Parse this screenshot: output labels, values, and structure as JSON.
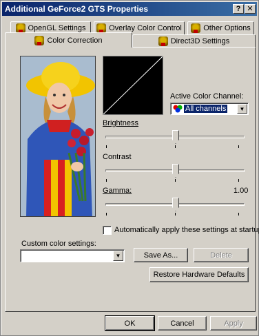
{
  "window": {
    "title": "Additional GeForce2 GTS Properties",
    "help_button": "?",
    "close_button": "✕"
  },
  "tabs_back": [
    {
      "label": "OpenGL Settings"
    },
    {
      "label": "Overlay Color Control"
    },
    {
      "label": "Other Options"
    }
  ],
  "tabs_front": [
    {
      "label": "Color Correction",
      "active": true
    },
    {
      "label": "Direct3D Settings",
      "active": false
    }
  ],
  "color_correction": {
    "active_channel_label": "Active Color Channel:",
    "active_channel_value": "All channels",
    "brightness_label": "Brightness",
    "brightness_level_percent": 50,
    "contrast_label": "Contrast",
    "contrast_level_percent": 50,
    "gamma_label": "Gamma:",
    "gamma_value": "1.00",
    "gamma_level_percent": 50,
    "auto_apply_label": "Automatically apply these settings at startup",
    "auto_apply_checked": false,
    "custom_settings_label": "Custom color settings:",
    "custom_settings_value": "",
    "save_as_label": "Save As...",
    "delete_label": "Delete",
    "restore_defaults_label": "Restore Hardware Defaults"
  },
  "dialog_buttons": {
    "ok": "OK",
    "cancel": "Cancel",
    "apply": "Apply"
  }
}
